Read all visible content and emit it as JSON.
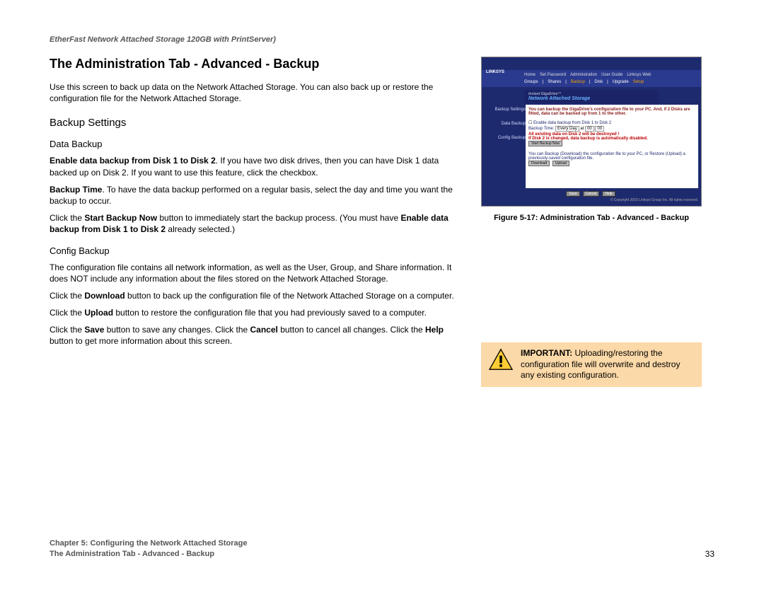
{
  "header": {
    "product": "EtherFast Network Attached Storage 120GB with PrintServer)"
  },
  "title": "The Administration Tab - Advanced - Backup",
  "intro": "Use this screen to back up data on the Network Attached Storage. You can also back up or restore the configuration file for the Network Attached Storage.",
  "backup_settings": {
    "heading": "Backup Settings",
    "data_backup": {
      "heading": "Data Backup",
      "p1_bold": "Enable data backup from Disk 1 to Disk 2",
      "p1_rest": ". If you have two disk drives, then you can have Disk 1 data backed up on Disk 2. If you want to use this feature, click the checkbox.",
      "p2_bold": "Backup Time",
      "p2_rest": ". To have the data backup performed on a regular basis, select the day and time you want the backup to occur.",
      "p3_pre": "Click the ",
      "p3_b1": "Start Backup Now",
      "p3_mid": " button to immediately start the backup process. (You must have ",
      "p3_b2": "Enable data backup from Disk 1 to Disk 2",
      "p3_end": " already selected.)"
    },
    "config_backup": {
      "heading": "Config Backup",
      "p1": "The configuration file contains all network information, as well as the User, Group, and Share information. It does NOT include any information about the files stored on the Network Attached Storage.",
      "p2_pre": "Click the ",
      "p2_b": "Download",
      "p2_end": " button to back up the configuration file of the Network Attached Storage on a computer.",
      "p3_pre": "Click the ",
      "p3_b": "Upload",
      "p3_end": " button to restore the configuration file that you had previously saved to a computer.",
      "p4_pre": "Click the ",
      "p4_b1": "Save",
      "p4_mid1": " button to save any changes. Click the ",
      "p4_b2": "Cancel",
      "p4_mid2": " button to cancel all changes. Click the ",
      "p4_b3": "Help",
      "p4_end": " button to get more information about this screen."
    }
  },
  "figure": {
    "caption": "Figure 5-17: Administration Tab - Advanced - Backup",
    "logo": "LINKSYS",
    "topnav": [
      "Home",
      "Set Password",
      "Administration",
      "User Guide",
      "Linksys Web"
    ],
    "subnav": [
      "Groups",
      "|",
      "Shares",
      "|",
      "Backup",
      "|",
      "Disk",
      "|",
      "Upgrade",
      "Setup"
    ],
    "brand1": "Instant GigaDrive™",
    "brand2": "Network Attached Storage",
    "side": [
      "Backup Settings",
      "Data Backup",
      "Config Backup"
    ],
    "hdr": "You can backup the GigaDrive's configuration file to your PC. And, if 2 Disks are fitted, data can be backed up from 1 to the other.",
    "enable": "Enable data backup from Disk 1 to Disk 2",
    "time_label": "Backup Time:",
    "time_sel": "Every Day",
    "warn1": "All existing data on Disk 2 will be destroyed !",
    "warn2": "If Disk 2 is changed, data backup is automatically disabled.",
    "start_btn": "Start Backup Now",
    "cfg_text": "You can Backup (Download) the configuration file to your PC, or Restore (Upload) a previously-saved configuration file.",
    "download": "Download",
    "upload": "Upload",
    "save": "Save",
    "cancel": "Cancel",
    "help": "Help",
    "copy": "© Copyright 2003 Linksys Group Inc. All rights reserved."
  },
  "callout": {
    "bold": "IMPORTANT:",
    "text": " Uploading/restoring the configuration file will overwrite and destroy any existing configuration."
  },
  "footer": {
    "chapter": "Chapter 5: Configuring the Network Attached Storage",
    "sub": "The Administration Tab - Advanced - Backup",
    "page": "33"
  }
}
